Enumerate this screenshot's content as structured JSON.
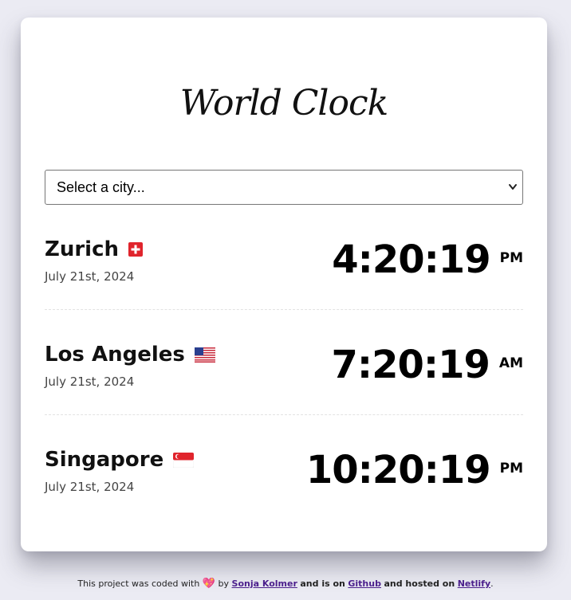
{
  "logo": {
    "text": "World Clock"
  },
  "select": {
    "value": "Select a city..."
  },
  "cities": [
    {
      "name": "Zurich",
      "flag_icon": "switzerland-flag-icon",
      "date": "July 21st, 2024",
      "time": "4:20:19",
      "ampm": "PM"
    },
    {
      "name": "Los Angeles",
      "flag_icon": "usa-flag-icon",
      "date": "July 21st, 2024",
      "time": "7:20:19",
      "ampm": "AM"
    },
    {
      "name": "Singapore",
      "flag_icon": "singapore-flag-icon",
      "date": "July 21st, 2024",
      "time": "10:20:19",
      "ampm": "PM"
    }
  ],
  "footer": {
    "prefix": "This project was coded with",
    "heart_icon": "heart-icon",
    "by": "by",
    "author": "Sonja Kolmer",
    "and_is_on": "and is on",
    "github": "Github",
    "and_hosted_on": "and hosted on",
    "netlify": "Netlify",
    "end": "."
  },
  "colors": {
    "background": "#ebebf3",
    "card": "#ffffff",
    "link": "#4b1f8c"
  }
}
